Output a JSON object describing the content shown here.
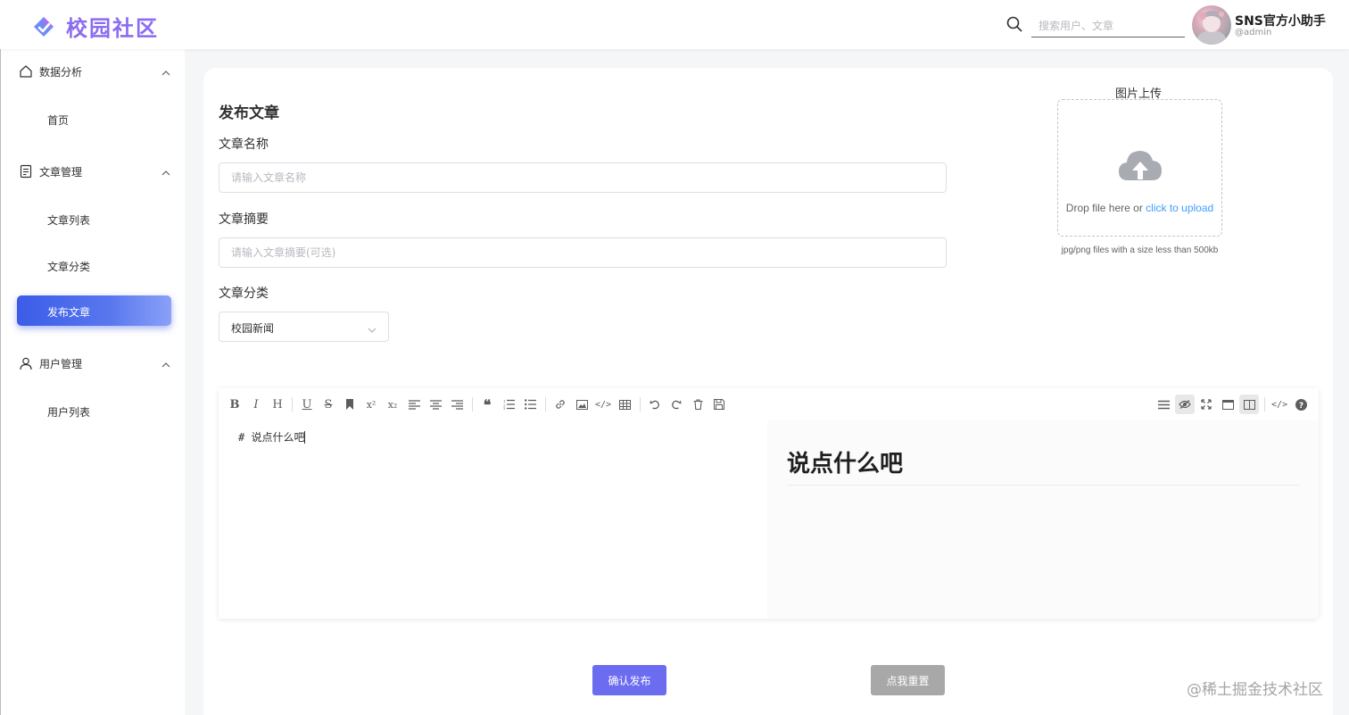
{
  "header": {
    "app_title": "校园社区",
    "search_placeholder": "搜索用户、文章",
    "user_name": "SNS官方小助手",
    "user_handle": "@admin"
  },
  "sidebar": {
    "groups": [
      {
        "label": "数据分析",
        "icon": "home-icon",
        "items": [
          {
            "label": "首页"
          }
        ]
      },
      {
        "label": "文章管理",
        "icon": "document-icon",
        "items": [
          {
            "label": "文章列表"
          },
          {
            "label": "文章分类"
          },
          {
            "label": "发布文章",
            "active": true
          }
        ]
      },
      {
        "label": "用户管理",
        "icon": "user-icon",
        "items": [
          {
            "label": "用户列表"
          }
        ]
      }
    ]
  },
  "form": {
    "title": "发布文章",
    "name_label": "文章名称",
    "name_placeholder": "请输入文章名称",
    "summary_label": "文章摘要",
    "summary_placeholder": "请输入文章摘要(可选)",
    "category_label": "文章分类",
    "category_value": "校园新闻"
  },
  "upload": {
    "title": "图片上传",
    "drop_text": "Drop file here or ",
    "click_text": "click to upload",
    "tip": "jpg/png files with a size less than 500kb"
  },
  "editor": {
    "content": "# 说点什么吧",
    "preview_heading": "说点什么吧"
  },
  "actions": {
    "publish_label": "确认发布",
    "reset_label": "点我重置"
  },
  "watermark": "@稀土掘金技术社区",
  "colors": {
    "brand": "#8b6cf0",
    "active_menu": "#3c5ce8",
    "publish_button": "#6c6cf0",
    "reset_button": "#a8a8a8",
    "link": "#409eff"
  }
}
